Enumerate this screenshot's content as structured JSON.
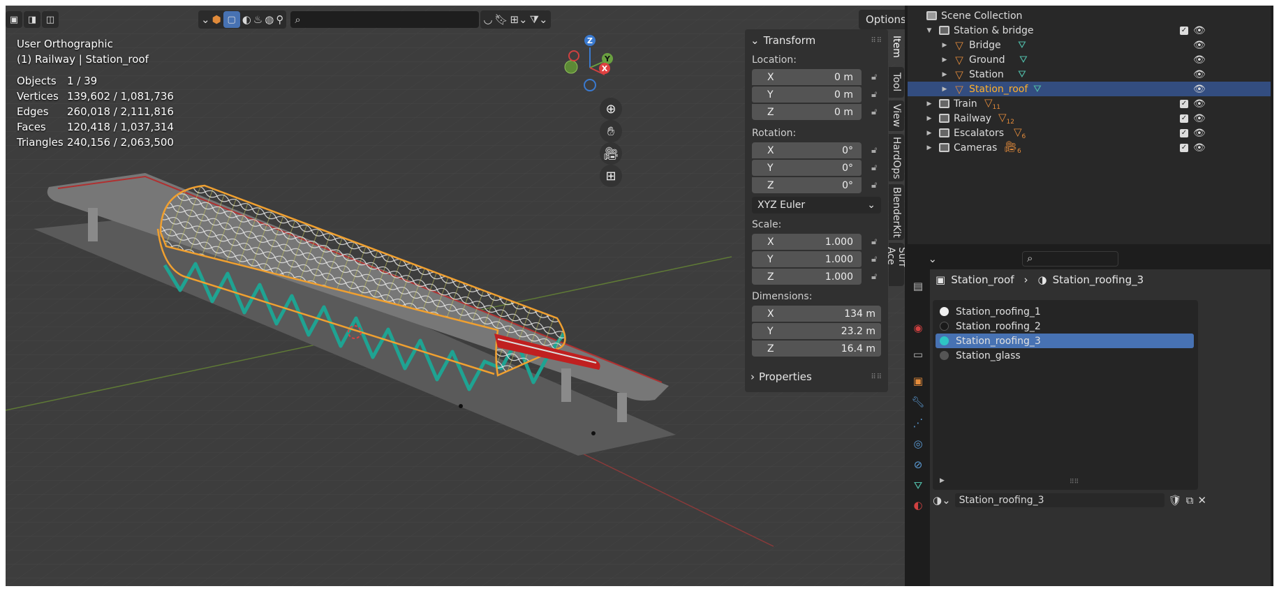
{
  "viewport": {
    "view_name": "User Orthographic",
    "context": "(1) Railway | Station_roof",
    "stats": [
      {
        "label": "Objects",
        "value": "1 / 39"
      },
      {
        "label": "Vertices",
        "value": "139,602 / 1,081,736"
      },
      {
        "label": "Edges",
        "value": "260,018 / 2,111,816"
      },
      {
        "label": "Faces",
        "value": "120,418 / 1,037,314"
      },
      {
        "label": "Triangles",
        "value": "240,156 / 2,063,500"
      }
    ],
    "options_label": "Options",
    "search_placeholder": "",
    "gizmo": {
      "z": "Z",
      "y": "Y",
      "x": "X"
    }
  },
  "npanel": {
    "transform_title": "Transform",
    "location_label": "Location:",
    "location": [
      {
        "axis": "X",
        "value": "0 m"
      },
      {
        "axis": "Y",
        "value": "0 m"
      },
      {
        "axis": "Z",
        "value": "0 m"
      }
    ],
    "rotation_label": "Rotation:",
    "rotation": [
      {
        "axis": "X",
        "value": "0°"
      },
      {
        "axis": "Y",
        "value": "0°"
      },
      {
        "axis": "Z",
        "value": "0°"
      }
    ],
    "rotation_mode": "XYZ Euler",
    "scale_label": "Scale:",
    "scale": [
      {
        "axis": "X",
        "value": "1.000"
      },
      {
        "axis": "Y",
        "value": "1.000"
      },
      {
        "axis": "Z",
        "value": "1.000"
      }
    ],
    "dimensions_label": "Dimensions:",
    "dimensions": [
      {
        "axis": "X",
        "value": "134 m"
      },
      {
        "axis": "Y",
        "value": "23.2 m"
      },
      {
        "axis": "Z",
        "value": "16.4 m"
      }
    ],
    "properties_title": "Properties",
    "tabs": [
      "Item",
      "Tool",
      "View",
      "HardOps",
      "BlenderKit",
      "Surf Ace"
    ]
  },
  "outliner": {
    "scene_collection": "Scene Collection",
    "rows": [
      {
        "name": "Station & bridge",
        "type": "collection",
        "expanded": true
      },
      {
        "name": "Bridge",
        "type": "mesh"
      },
      {
        "name": "Ground",
        "type": "mesh"
      },
      {
        "name": "Station",
        "type": "mesh"
      },
      {
        "name": "Station_roof",
        "type": "mesh",
        "selected": true
      },
      {
        "name": "Train",
        "type": "collection",
        "badge": "11"
      },
      {
        "name": "Railway",
        "type": "collection",
        "badge": "12"
      },
      {
        "name": "Escalators",
        "type": "collection",
        "badge": "6"
      },
      {
        "name": "Cameras",
        "type": "collection",
        "badge": "6"
      }
    ]
  },
  "properties": {
    "object_name": "Station_roof",
    "material_name": "Station_roofing_3",
    "materials": [
      {
        "name": "Station_roofing_1",
        "color": "#f0f0f0"
      },
      {
        "name": "Station_roofing_2",
        "color": "#1a1a1a"
      },
      {
        "name": "Station_roofing_3",
        "color": "#2ec4c4",
        "selected": true
      },
      {
        "name": "Station_glass",
        "color": "#555555"
      }
    ],
    "active_material_field": "Station_roofing_3"
  },
  "colors": {
    "accent": "#4772b3",
    "selection_orange": "#ffaf29",
    "roof_outline": "#f0a030",
    "truss": "#1fa392"
  }
}
